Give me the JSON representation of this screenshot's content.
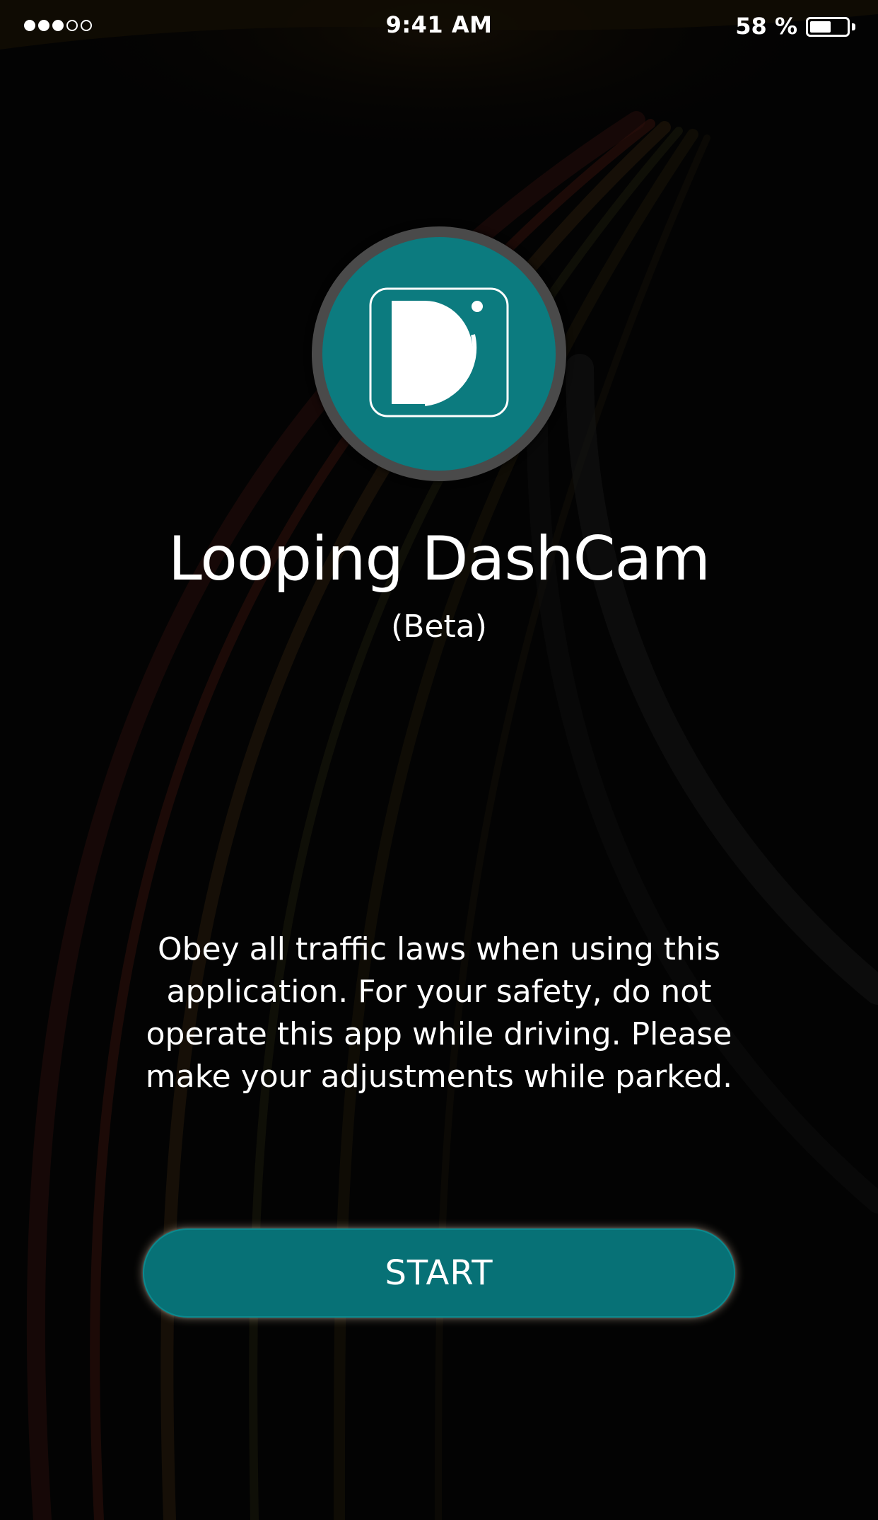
{
  "status_bar": {
    "signal_dots_filled": 3,
    "signal_dots_total": 5,
    "time": "9:41 AM",
    "battery_text": "58 %",
    "battery_level": 0.58
  },
  "app": {
    "title": "Looping DashCam",
    "subtitle": "(Beta)",
    "logo_icon": "dashcam-d-logo-icon",
    "disclaimer": "Obey all traffic laws when using this application. For your safety, do not operate this app while driving. Please make your adjustments while parked."
  },
  "actions": {
    "start_label": "START"
  },
  "colors": {
    "accent": "#0c7b7f",
    "button": "#077176",
    "text": "#ffffff",
    "background": "#050505"
  }
}
